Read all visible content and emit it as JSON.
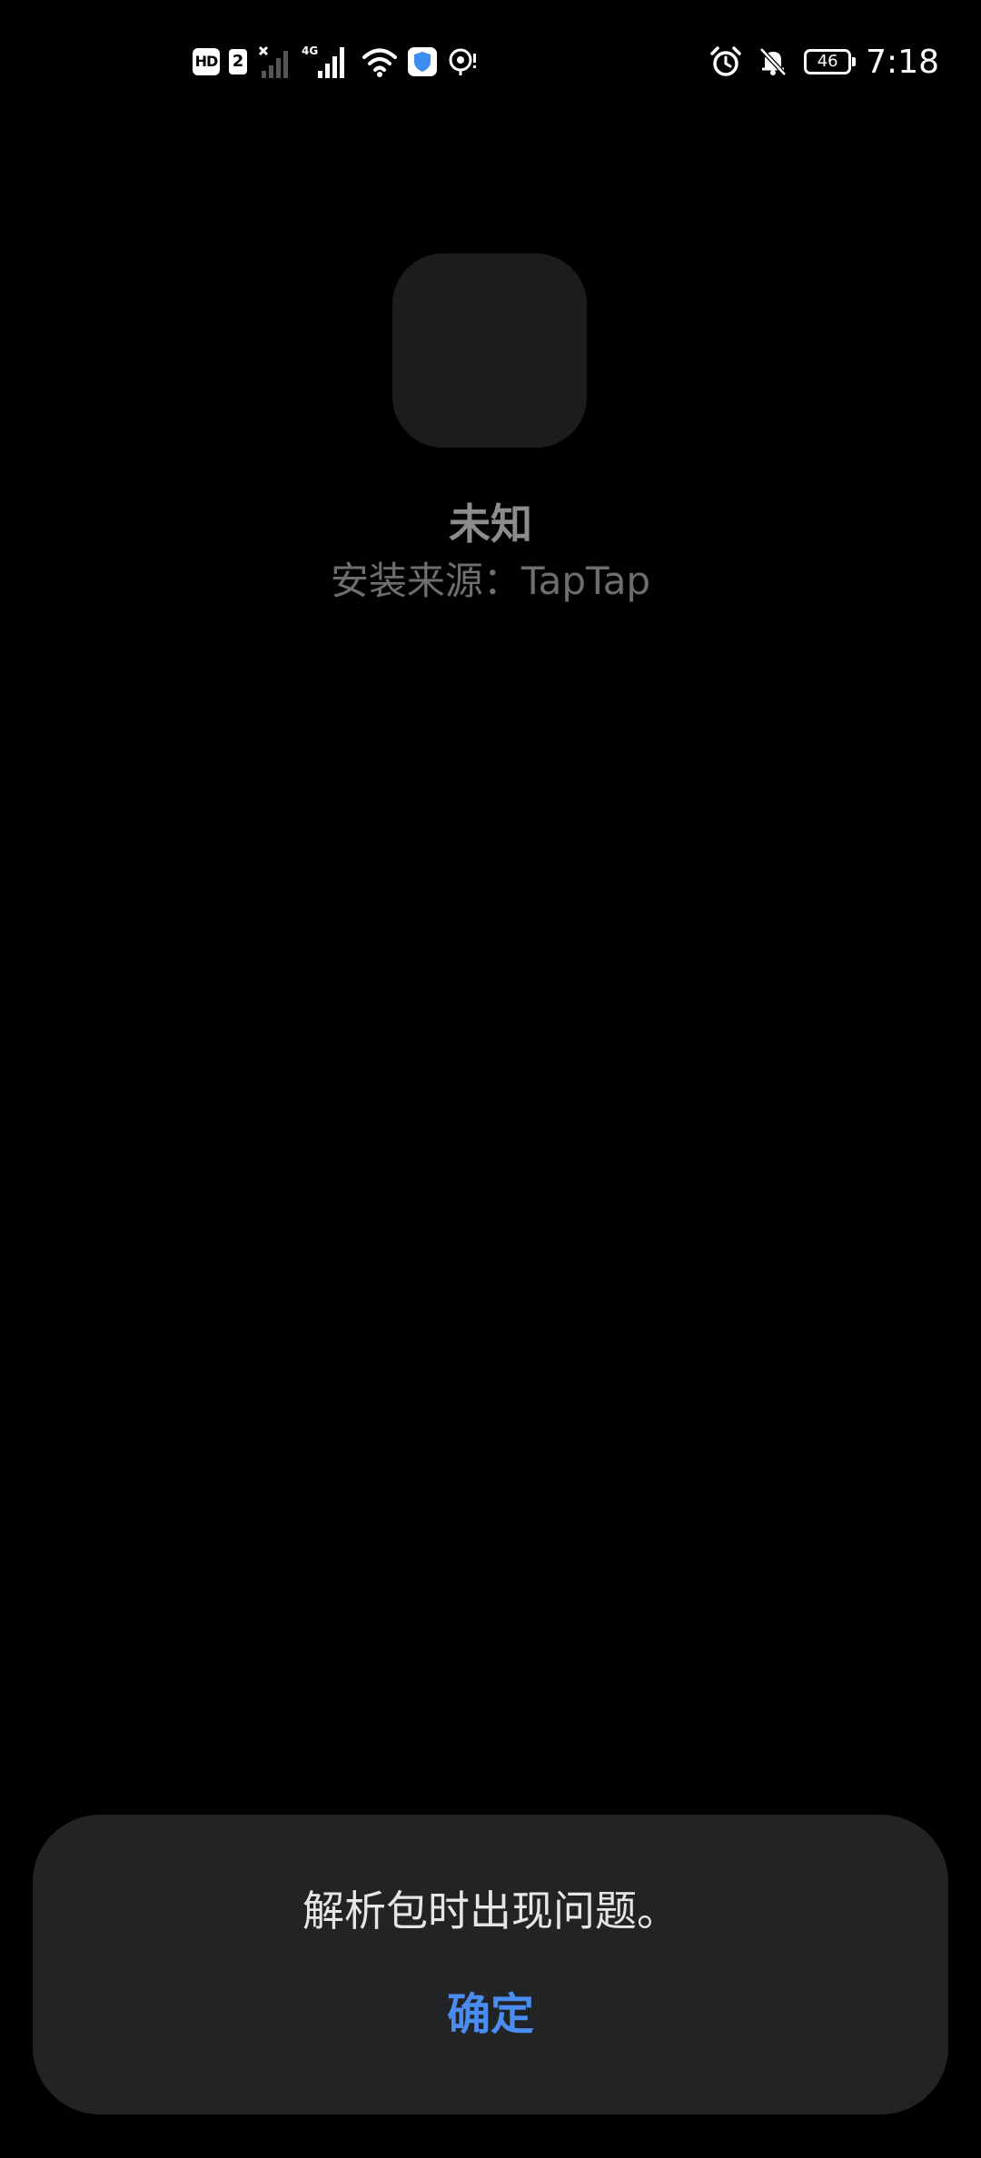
{
  "status_bar": {
    "left_icons": [
      "hd-voice-icon",
      "sim-2-icon",
      "no-signal-icon",
      "signal-4g-icon",
      "wifi-icon",
      "shield-icon",
      "location-icon"
    ],
    "hd_label": "HD",
    "sim_label": "2",
    "network_label": "4G",
    "battery_level": "46",
    "time": "7:18"
  },
  "app": {
    "name": "未知",
    "install_source": "安装来源：TapTap"
  },
  "dialog": {
    "message": "解析包时出现问题。",
    "confirm_label": "确定"
  },
  "colors": {
    "background": "#000000",
    "dialog_background": "#222324",
    "accent": "#4a8cf0",
    "icon_placeholder": "#1c1c1c"
  }
}
